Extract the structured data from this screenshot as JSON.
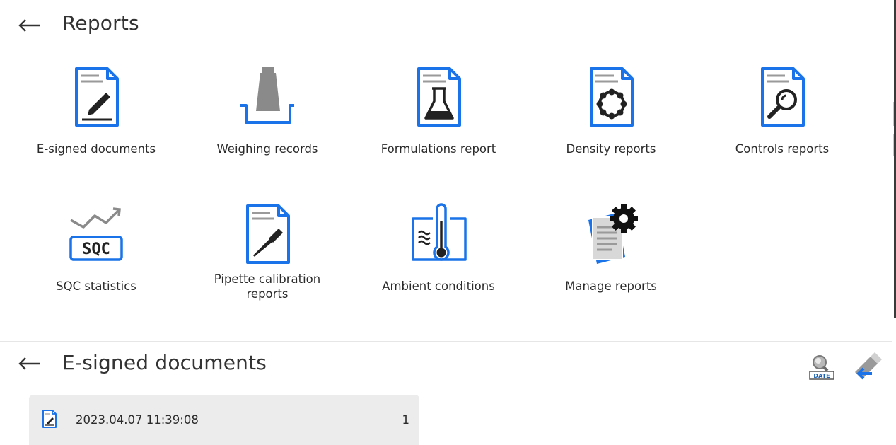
{
  "reports": {
    "title": "Reports",
    "tiles": [
      {
        "label": "E-signed documents",
        "icon": "e-signed-documents-icon"
      },
      {
        "label": "Weighing records",
        "icon": "weighing-records-icon"
      },
      {
        "label": "Formulations report",
        "icon": "formulations-report-icon"
      },
      {
        "label": "Density reports",
        "icon": "density-reports-icon"
      },
      {
        "label": "Controls reports",
        "icon": "controls-reports-icon"
      },
      {
        "label": "SQC statistics",
        "icon": "sqc-statistics-icon",
        "icon_text": "SQC"
      },
      {
        "label_line1": "Pipette calibration",
        "label_line2": "reports",
        "icon": "pipette-calibration-icon"
      },
      {
        "label": "Ambient conditions",
        "icon": "ambient-conditions-icon"
      },
      {
        "label": "Manage reports",
        "icon": "manage-reports-icon"
      }
    ]
  },
  "esigned": {
    "title": "E-signed documents",
    "toolbar": {
      "date_search_label": "DATE",
      "date_search_icon": "date-search-icon",
      "export_icon": "usb-export-icon"
    },
    "rows": [
      {
        "date": "2023.04.07 11:39:08",
        "count": "1"
      }
    ]
  },
  "colors": {
    "accent_blue": "#1a73e8",
    "dark_icon": "#222222",
    "gray_icon": "#8a8a8a",
    "row_background": "#ececec"
  }
}
